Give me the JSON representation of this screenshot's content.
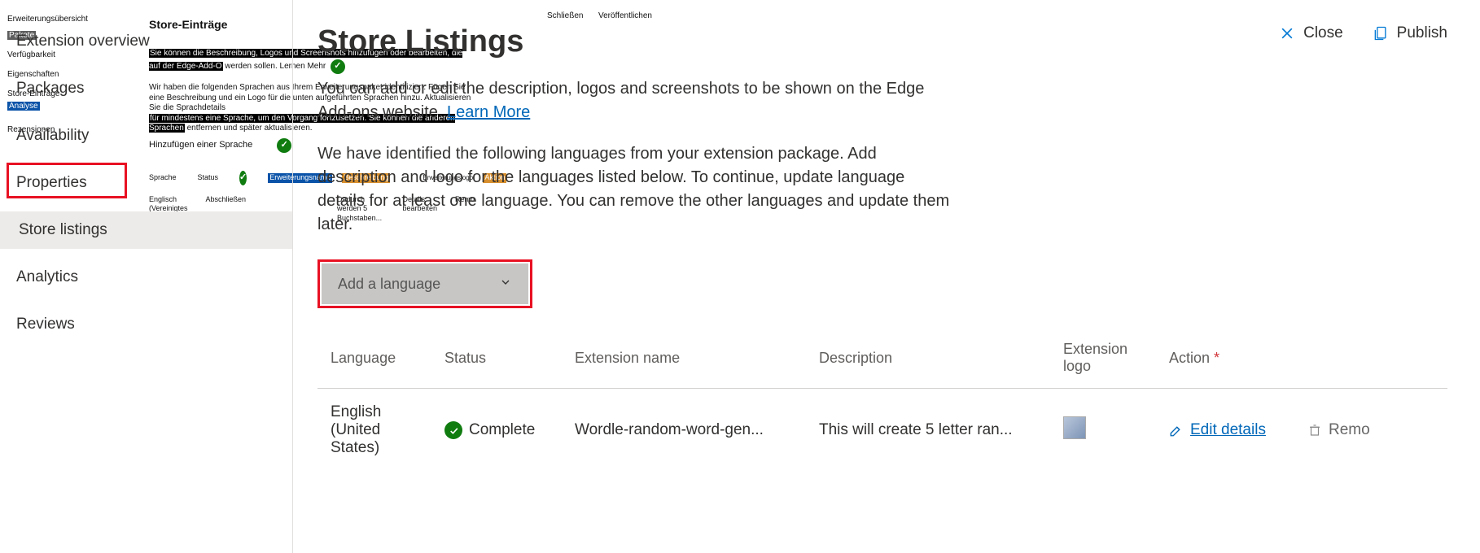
{
  "ghost": {
    "nav": {
      "ext_overview": "Erweiterungsübersicht",
      "pakete": "Pakete",
      "verfugbarkeit": "Verfügbarkeit",
      "eigenschaften": "Eigenschaften",
      "store_eintrage": "Store-Einträge",
      "analyse": "Analyse",
      "rezensionen": "Rezensionen"
    },
    "body": {
      "heading": "Store-Einträge",
      "top_actions": {
        "close": "Schließen",
        "publish": "Veröffentlichen"
      },
      "p1_hl": "Sie können die Beschreibung, Logos und Screenshots hinzufügen oder bearbeiten, die auf der Edge-Add-O",
      "p1_tail": "werden sollen. Lernen   Mehr",
      "p2a": "Wir haben die folgenden Sprachen aus Ihrem Erweiterungspaket identifiziert.  Fügen Sie eine Beschreibung und ein Logo für die unten aufgeführten Sprachen hinzu. Aktualisieren Sie die Sprachdetails",
      "p2_hl": "für mindestens eine Sprache, um den Vorgang fortzusetzen. Sie können die anderen Sprachen",
      "p2_tail": "entfernen und später aktualisieren.",
      "add_lang": "Hinzufügen einer Sprache",
      "th": {
        "sprache": "Sprache",
        "status": "Status",
        "ext_name": "Erweiterungsname",
        "beschreibung": "Beschreibung",
        "logo": "Erweiterungslogo",
        "aktion": "Aktion"
      },
      "row": {
        "lang": "Englisch (Vereinigtes Königreich) Zustände)",
        "status": "Abschließen",
        "desc_hint": "Dadurch werden 5 Buchstaben...",
        "edit": "Details bearbeiten",
        "remove": "Remo"
      }
    }
  },
  "sidebar": {
    "items": [
      {
        "label": "Extension overview"
      },
      {
        "label": "Packages"
      },
      {
        "label": "Availability"
      },
      {
        "label": "Properties"
      },
      {
        "label": "Store listings"
      },
      {
        "label": "Analytics"
      },
      {
        "label": "Reviews"
      }
    ]
  },
  "header": {
    "close": "Close",
    "publish": "Publish"
  },
  "page": {
    "title": "Store Listings",
    "intro_pre": "You can add or edit the description, logos and screenshots to be shown on the Edge Add-ons website. ",
    "intro_link": "Learn More",
    "para2": "We have identified the following languages from your extension package. Add description and logo for the languages listed below. To continue, update language details for at least one language. You can remove the other languages and update them later.",
    "add_language": "Add a language"
  },
  "table": {
    "headers": {
      "language": "Language",
      "status": "Status",
      "ext_name": "Extension name",
      "description": "Description",
      "logo": "Extension logo",
      "action": "Action"
    },
    "required_mark": "*",
    "rows": [
      {
        "language": "English (United States)",
        "status": "Complete",
        "ext_name": "Wordle-random-word-gen...",
        "description": "This will create 5 letter ran...",
        "edit": "Edit details",
        "remove": "Remo"
      }
    ]
  }
}
